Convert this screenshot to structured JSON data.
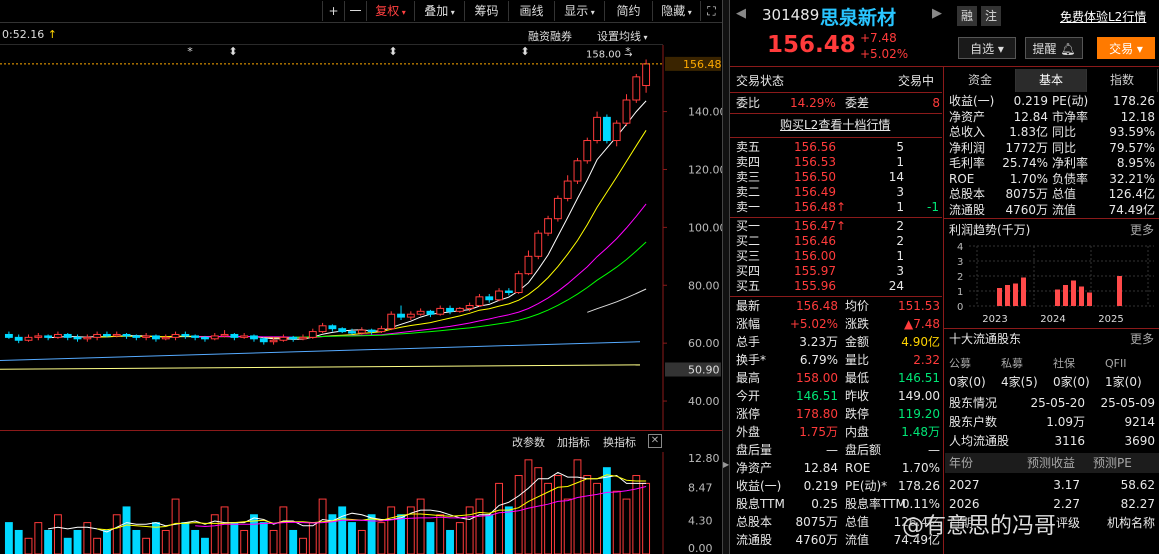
{
  "toolbar": {
    "plus": "+",
    "minus": "一",
    "fuquan": "复权",
    "diejia": "叠加",
    "chouma": "筹码",
    "huaxian": "画线",
    "xianshi": "显示",
    "jianyue": "简约",
    "yincang": "隐藏"
  },
  "chart": {
    "time_label": "0:52.16",
    "rzrq": "融资融券",
    "avg_setting": "设置均线",
    "high_label": "158.00",
    "last_price_tag": "156.48",
    "level_50": "50.90",
    "price_ticks": [
      "140.00",
      "120.00",
      "100.00",
      "80.00",
      "60.00",
      "40.00"
    ],
    "vol_ticks": [
      "12.80",
      "8.47",
      "4.30",
      "0.00"
    ],
    "indicator_tabs": {
      "change": "改参数",
      "add": "加指标",
      "swap": "换指标"
    }
  },
  "stock": {
    "code": "301489",
    "name": "思泉新材",
    "price": "156.48",
    "change": "+7.48",
    "pct": "+5.02%",
    "rong": "融",
    "zhu": "注",
    "l2_link": "免费体验L2行情",
    "self_select": "自选",
    "alert": "提醒",
    "trade": "交易"
  },
  "status": {
    "label": "交易状态",
    "value": "交易中",
    "weibi_label": "委比",
    "weibi": "14.29%",
    "weicha_label": "委差",
    "weicha": "8",
    "buy_l2": "购买L2查看十档行情"
  },
  "asks": [
    {
      "label": "卖五",
      "price": "156.56",
      "vol": "5",
      "chg": ""
    },
    {
      "label": "卖四",
      "price": "156.53",
      "vol": "1",
      "chg": ""
    },
    {
      "label": "卖三",
      "price": "156.50",
      "vol": "14",
      "chg": ""
    },
    {
      "label": "卖二",
      "price": "156.49",
      "vol": "3",
      "chg": ""
    },
    {
      "label": "卖一",
      "price": "156.48↑",
      "vol": "1",
      "chg": "-1"
    }
  ],
  "bids": [
    {
      "label": "买一",
      "price": "156.47↑",
      "vol": "2"
    },
    {
      "label": "买二",
      "price": "156.46",
      "vol": "2"
    },
    {
      "label": "买三",
      "price": "156.00",
      "vol": "1"
    },
    {
      "label": "买四",
      "price": "155.97",
      "vol": "3"
    },
    {
      "label": "买五",
      "price": "155.96",
      "vol": "24"
    }
  ],
  "quote": [
    {
      "l1": "最新",
      "v1": "156.48",
      "c1": "red",
      "l2": "均价",
      "v2": "151.53",
      "c2": "red"
    },
    {
      "l1": "涨幅",
      "v1": "+5.02%",
      "c1": "red",
      "l2": "涨跌",
      "v2": "▲7.48",
      "c2": "red"
    },
    {
      "l1": "总手",
      "v1": "3.23万",
      "c1": "wht",
      "l2": "金额",
      "v2": "4.90亿",
      "c2": "yel"
    },
    {
      "l1": "换手*",
      "v1": "6.79%",
      "c1": "wht",
      "l2": "量比",
      "v2": "2.32",
      "c2": "red"
    },
    {
      "l1": "最高",
      "v1": "158.00",
      "c1": "red",
      "l2": "最低",
      "v2": "146.51",
      "c2": "grn"
    },
    {
      "l1": "今开",
      "v1": "146.51",
      "c1": "grn",
      "l2": "昨收",
      "v2": "149.00",
      "c2": "wht"
    },
    {
      "l1": "涨停",
      "v1": "178.80",
      "c1": "red",
      "l2": "跌停",
      "v2": "119.20",
      "c2": "grn"
    },
    {
      "l1": "外盘",
      "v1": "1.75万",
      "c1": "red",
      "l2": "内盘",
      "v2": "1.48万",
      "c2": "grn"
    },
    {
      "l1": "盘后量",
      "v1": "—",
      "c1": "wht",
      "l2": "盘后额",
      "v2": "—",
      "c2": "wht"
    },
    {
      "l1": "净资产",
      "v1": "12.84",
      "c1": "wht",
      "l2": "ROE",
      "v2": "1.70%",
      "c2": "wht"
    },
    {
      "l1": "收益(一)",
      "v1": "0.219",
      "c1": "wht",
      "l2": "PE(动)*",
      "v2": "178.26",
      "c2": "wht"
    },
    {
      "l1": "股息TTM",
      "v1": "0.25",
      "c1": "wht",
      "l2": "股息率TTM",
      "v2": "0.11%",
      "c2": "wht"
    },
    {
      "l1": "总股本",
      "v1": "8075万",
      "c1": "wht",
      "l2": "总值",
      "v2": "126.4亿",
      "c2": "wht"
    },
    {
      "l1": "流通股",
      "v1": "4760万",
      "c1": "wht",
      "l2": "流值",
      "v2": "74.49亿",
      "c2": "wht"
    }
  ],
  "tabs": [
    "资金",
    "基本",
    "指数"
  ],
  "fundamentals": [
    {
      "l1": "收益(一)",
      "v1": "0.219",
      "l2": "PE(动)",
      "v2": "178.26"
    },
    {
      "l1": "净资产",
      "v1": "12.84",
      "l2": "市净率",
      "v2": "12.18"
    },
    {
      "l1": "总收入",
      "v1": "1.83亿",
      "l2": "同比",
      "v2": "93.59%"
    },
    {
      "l1": "净利润",
      "v1": "1772万",
      "l2": "同比",
      "v2": "79.57%"
    },
    {
      "l1": "毛利率",
      "v1": "25.74%",
      "l2": "净利率",
      "v2": "8.95%"
    },
    {
      "l1": "ROE",
      "v1": "1.70%",
      "l2": "负债率",
      "v2": "32.21%"
    },
    {
      "l1": "总股本",
      "v1": "8075万",
      "l2": "总值",
      "v2": "126.4亿"
    },
    {
      "l1": "流通股",
      "v1": "4760万",
      "l2": "流值",
      "v2": "74.49亿"
    }
  ],
  "profit": {
    "title": "利润趋势(千万)",
    "more": "更多",
    "yticks": [
      "4",
      "3",
      "2",
      "1",
      "0"
    ],
    "years": [
      "2023",
      "2024",
      "2025"
    ]
  },
  "holders": {
    "title": "十大流通股东",
    "more": "更多",
    "heads": [
      "公募",
      "私募",
      "社保",
      "QFII"
    ],
    "vals": [
      "0家(0)",
      "4家(5)",
      "0家(0)",
      "1家(0)"
    ],
    "rows": [
      {
        "l": "股东情况",
        "a": "25-05-20",
        "b": "25-05-09"
      },
      {
        "l": "股东户数",
        "a": "1.09万",
        "b": "9214"
      },
      {
        "l": "人均流通股",
        "a": "3116",
        "b": "3690"
      }
    ]
  },
  "forecast": {
    "heads": [
      "年份",
      "预测收益",
      "预测PE"
    ],
    "rows": [
      {
        "y": "2027",
        "e": "3.17",
        "pe": "58.62"
      },
      {
        "y": "2026",
        "e": "2.27",
        "pe": "82.27"
      },
      {
        "y": "日期",
        "e": "评级",
        "pe": "机构名称"
      }
    ]
  },
  "watermark": "@有意思的冯哥",
  "chart_data": {
    "type": "candlestick",
    "note_ylim": [
      30,
      163
    ],
    "candles": [
      [
        63,
        62,
        64,
        61.5
      ],
      [
        62,
        61,
        63,
        60
      ],
      [
        61,
        62,
        63,
        60.5
      ],
      [
        62,
        62.5,
        63.5,
        61
      ],
      [
        62.5,
        62,
        63,
        61
      ],
      [
        62,
        63,
        64,
        61.5
      ],
      [
        63,
        62,
        63.5,
        61
      ],
      [
        62,
        61.5,
        63,
        60.5
      ],
      [
        61.5,
        62,
        63,
        60.5
      ],
      [
        62,
        63,
        64,
        61
      ],
      [
        63,
        62.5,
        64,
        62
      ],
      [
        62.5,
        63,
        64,
        62
      ],
      [
        63,
        62.5,
        63.5,
        61.5
      ],
      [
        62.5,
        62,
        63,
        61
      ],
      [
        62,
        62.5,
        63.5,
        61
      ],
      [
        62.5,
        61.5,
        63,
        60.5
      ],
      [
        61.5,
        62,
        63,
        61
      ],
      [
        62,
        63,
        64,
        61
      ],
      [
        63,
        62.5,
        64,
        61.5
      ],
      [
        62.5,
        62,
        63,
        61
      ],
      [
        62,
        61.5,
        62.5,
        60.5
      ],
      [
        61.5,
        62.5,
        63.5,
        61
      ],
      [
        62.5,
        63,
        64.5,
        62
      ],
      [
        63,
        62,
        63.5,
        61
      ],
      [
        62,
        62.5,
        63.5,
        61.5
      ],
      [
        62.5,
        61.5,
        63,
        60.5
      ],
      [
        61.5,
        60.5,
        62,
        59.5
      ],
      [
        60.5,
        61,
        62,
        59.5
      ],
      [
        61,
        62,
        63,
        60.5
      ],
      [
        62,
        61.5,
        62.5,
        60.5
      ],
      [
        61.5,
        62,
        63,
        61
      ],
      [
        62,
        64,
        65,
        61.5
      ],
      [
        64,
        66,
        67,
        63.5
      ],
      [
        66,
        65,
        66.5,
        64
      ],
      [
        65,
        64,
        65.5,
        63.5
      ],
      [
        64,
        63.5,
        65,
        63
      ],
      [
        63.5,
        64.5,
        65.5,
        63
      ],
      [
        64.5,
        64,
        65,
        63
      ],
      [
        64,
        65,
        66,
        63.5
      ],
      [
        65,
        70,
        71,
        64.5
      ],
      [
        70,
        69,
        73,
        68
      ],
      [
        69,
        70,
        71,
        68
      ],
      [
        70,
        71,
        72,
        69.5
      ],
      [
        71,
        70,
        71.5,
        69
      ],
      [
        70,
        72,
        73,
        69.5
      ],
      [
        72,
        71,
        73,
        70
      ],
      [
        71,
        72,
        72.5,
        70.5
      ],
      [
        72,
        73,
        74,
        71
      ],
      [
        73,
        76,
        77,
        72.5
      ],
      [
        76,
        75,
        77,
        74
      ],
      [
        75,
        78,
        79,
        74.5
      ],
      [
        78,
        77.5,
        79,
        76.5
      ],
      [
        77.5,
        84,
        85,
        77
      ],
      [
        84,
        90,
        92,
        83.5
      ],
      [
        90,
        98,
        99,
        89
      ],
      [
        98,
        103,
        104,
        97
      ],
      [
        103,
        110,
        111,
        102
      ],
      [
        110,
        116,
        118,
        109
      ],
      [
        116,
        123,
        124,
        115
      ],
      [
        123,
        130,
        131,
        122
      ],
      [
        130,
        138,
        140,
        129
      ],
      [
        138,
        130,
        139,
        129
      ],
      [
        130,
        136,
        137,
        128
      ],
      [
        136,
        144,
        146,
        135
      ],
      [
        144,
        152,
        153,
        143
      ],
      [
        149,
        156.48,
        158,
        146.51
      ]
    ]
  }
}
